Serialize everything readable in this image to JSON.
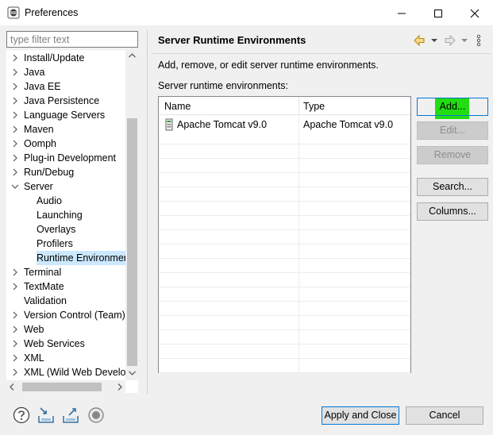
{
  "window": {
    "title": "Preferences",
    "minimize_icon": "minimize-icon",
    "maximize_icon": "maximize-icon",
    "close_icon": "close-icon"
  },
  "sidebar": {
    "filter_placeholder": "type filter text",
    "items": [
      {
        "label": "Install/Update",
        "twisty": "collapsed"
      },
      {
        "label": "Java",
        "twisty": "collapsed"
      },
      {
        "label": "Java EE",
        "twisty": "collapsed"
      },
      {
        "label": "Java Persistence",
        "twisty": "collapsed"
      },
      {
        "label": "Language Servers",
        "twisty": "collapsed"
      },
      {
        "label": "Maven",
        "twisty": "collapsed"
      },
      {
        "label": "Oomph",
        "twisty": "collapsed"
      },
      {
        "label": "Plug-in Development",
        "twisty": "collapsed"
      },
      {
        "label": "Run/Debug",
        "twisty": "collapsed"
      },
      {
        "label": "Server",
        "twisty": "expanded"
      },
      {
        "label": "Audio",
        "twisty": "none",
        "child": true
      },
      {
        "label": "Launching",
        "twisty": "none",
        "child": true
      },
      {
        "label": "Overlays",
        "twisty": "none",
        "child": true
      },
      {
        "label": "Profilers",
        "twisty": "none",
        "child": true
      },
      {
        "label": "Runtime Environmen",
        "twisty": "none",
        "child": true,
        "selected": true
      },
      {
        "label": "Terminal",
        "twisty": "collapsed"
      },
      {
        "label": "TextMate",
        "twisty": "collapsed"
      },
      {
        "label": "Validation",
        "twisty": "none"
      },
      {
        "label": "Version Control (Team)",
        "twisty": "collapsed"
      },
      {
        "label": "Web",
        "twisty": "collapsed"
      },
      {
        "label": "Web Services",
        "twisty": "collapsed"
      },
      {
        "label": "XML",
        "twisty": "collapsed"
      },
      {
        "label": "XML (Wild Web Develop",
        "twisty": "collapsed"
      }
    ]
  },
  "page": {
    "title": "Server Runtime Environments",
    "description": "Add, remove, or edit server runtime environments.",
    "list_label": "Server runtime environments:",
    "table": {
      "columns": [
        "Name",
        "Type"
      ],
      "rows": [
        {
          "name": "Apache Tomcat v9.0",
          "type": "Apache Tomcat v9.0",
          "icon": "server-runtime-icon"
        }
      ]
    },
    "buttons": {
      "add": "Add...",
      "edit": "Edit...",
      "remove": "Remove",
      "search": "Search...",
      "columns": "Columns..."
    },
    "highlight_color": "#22dd11"
  },
  "footer": {
    "icons": [
      "help-icon",
      "import-icon",
      "export-icon",
      "record-icon"
    ],
    "apply_close": "Apply and Close",
    "cancel": "Cancel"
  }
}
